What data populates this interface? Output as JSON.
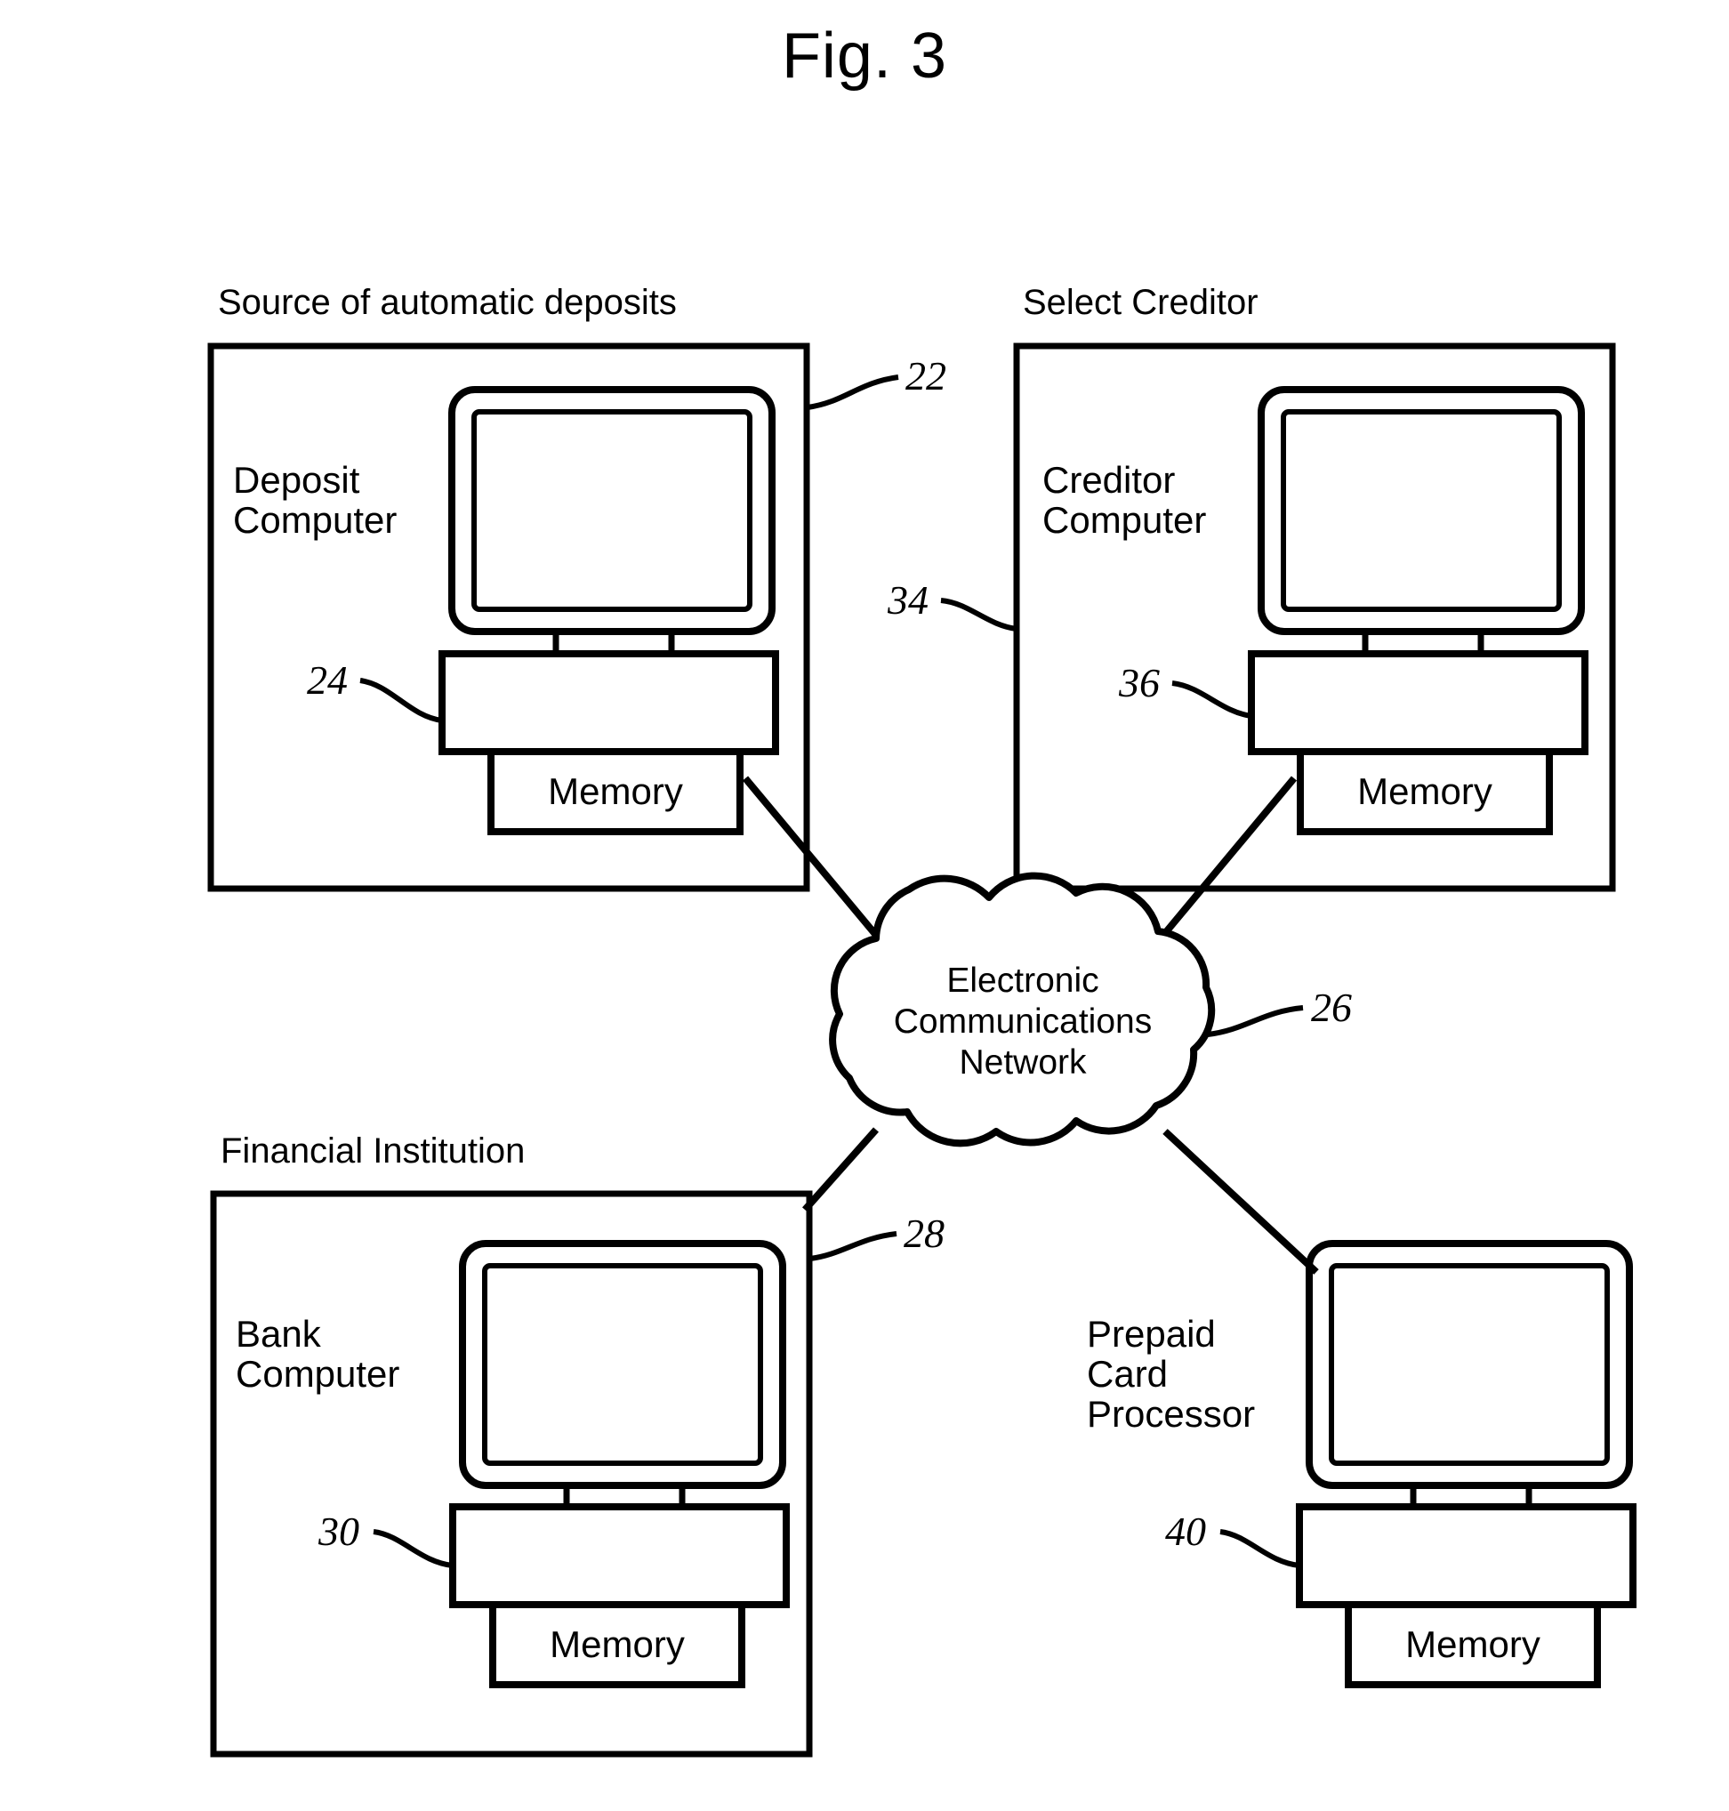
{
  "figure": {
    "title": "Fig. 3"
  },
  "groups": [
    {
      "id": "source-of-automatic-deposits",
      "title": "Source of automatic deposits"
    },
    {
      "id": "select-creditor",
      "title": "Select Creditor"
    },
    {
      "id": "financial-institution",
      "title": "Financial Institution"
    }
  ],
  "nodes": [
    {
      "id": "deposit-computer",
      "label": "Deposit\nComputer",
      "memory_label": "Memory"
    },
    {
      "id": "creditor-computer",
      "label": "Creditor\nComputer",
      "memory_label": "Memory"
    },
    {
      "id": "bank-computer",
      "label": "Bank\nComputer",
      "memory_label": "Memory"
    },
    {
      "id": "prepaid-card-processor",
      "label": "Prepaid\nCard\nProcessor",
      "memory_label": "Memory"
    }
  ],
  "cloud": {
    "label": "Electronic\nCommunications\nNetwork"
  },
  "reference_numerals": [
    {
      "id": "ref-22",
      "value": "22",
      "points_to": "deposit-computer-monitor"
    },
    {
      "id": "ref-24",
      "value": "24",
      "points_to": "deposit-computer-base"
    },
    {
      "id": "ref-34",
      "value": "34",
      "points_to": "select-creditor-group"
    },
    {
      "id": "ref-36",
      "value": "36",
      "points_to": "creditor-computer-base"
    },
    {
      "id": "ref-26",
      "value": "26",
      "points_to": "electronic-communications-network"
    },
    {
      "id": "ref-28",
      "value": "28",
      "points_to": "bank-computer-monitor"
    },
    {
      "id": "ref-30",
      "value": "30",
      "points_to": "bank-computer-base"
    },
    {
      "id": "ref-40",
      "value": "40",
      "points_to": "prepaid-card-processor-base"
    }
  ],
  "colors": {
    "stroke": "#000000",
    "background": "#ffffff"
  }
}
